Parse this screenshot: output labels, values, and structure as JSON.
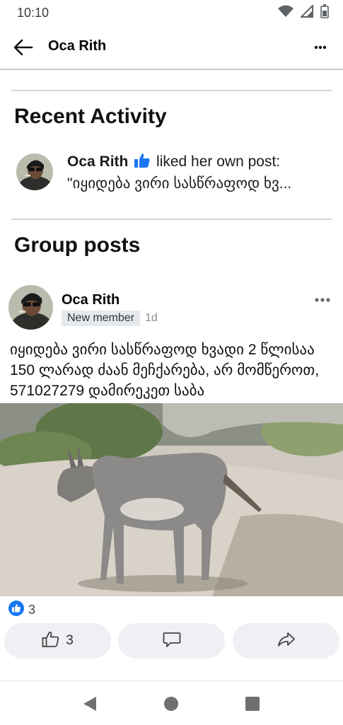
{
  "status_bar": {
    "time": "10:10",
    "icons": [
      "wifi-icon",
      "cell-signal-icon",
      "battery-icon"
    ]
  },
  "app_bar": {
    "title": "Oca Rith",
    "back_icon": "arrow-left-icon",
    "more_icon": "more-horizontal-icon"
  },
  "recent_activity": {
    "heading": "Recent Activity",
    "item": {
      "name": "Oca Rith",
      "action": " liked her own post:",
      "snippet": "\"იყიდება ვირი სასწრაფოდ ხვ..."
    }
  },
  "group_posts": {
    "heading": "Group posts",
    "post": {
      "author": "Oca Rith",
      "badge": "New member",
      "time": "1d",
      "text": "იყიდება ვირი სასწრაფოდ ხვადი 2 წლისაა 150 ლარად ძაან მეჩქარება, არ მომწეროთ, 571027279 დამირეკეთ საბა",
      "photo_subject": "donkey-photo",
      "reactions": {
        "count": "3",
        "icon": "like-reaction-icon"
      },
      "actions": {
        "like_count": "3",
        "like_icon": "thumbs-up-icon",
        "comment_icon": "comment-icon",
        "share_icon": "share-icon"
      }
    }
  },
  "nav_bar": {
    "icons": [
      "back-triangle-icon",
      "home-circle-icon",
      "recents-square-icon"
    ]
  },
  "colors": {
    "facebook_blue": "#1877f2",
    "button_bg": "#eef0f3",
    "muted_text": "#8a8d91"
  }
}
